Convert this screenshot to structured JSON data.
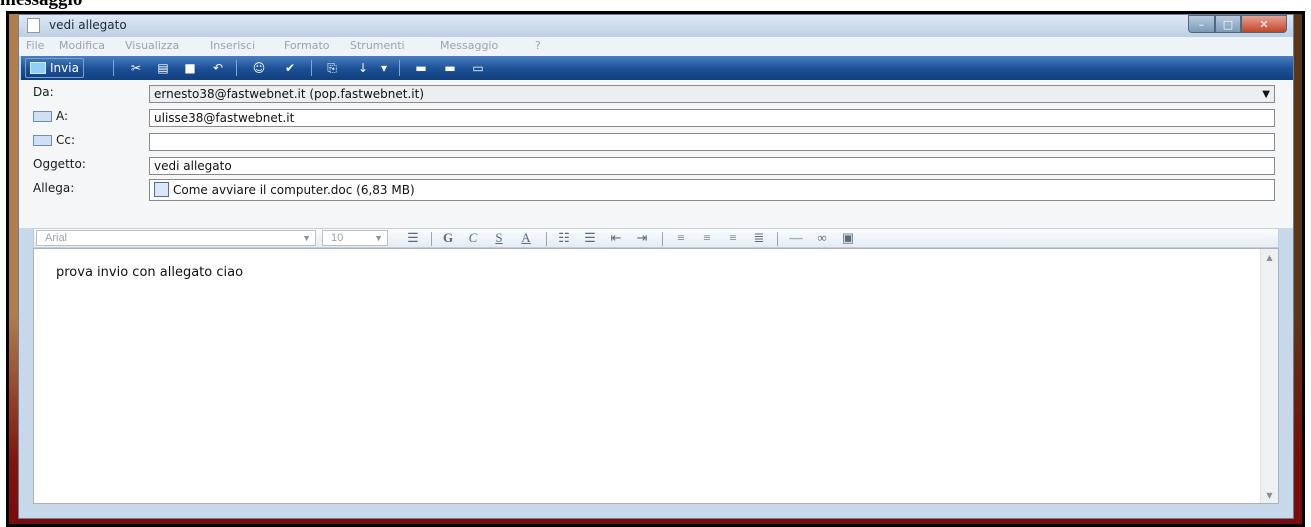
{
  "caption": "messaggio",
  "window": {
    "title": "vedi allegato"
  },
  "window_buttons": {
    "minimize": "–",
    "maximize": "□",
    "close": "✕"
  },
  "menu": [
    "File",
    "Modifica",
    "Visualizza",
    "Inserisci",
    "Formato",
    "Strumenti",
    "Messaggio",
    "?"
  ],
  "toolbar": {
    "send_label": "Invia"
  },
  "form": {
    "from": {
      "label": "Da:",
      "value": "ernesto38@fastwebnet.it   (pop.fastwebnet.it)"
    },
    "to": {
      "label": "A:",
      "value": "ulisse38@fastwebnet.it"
    },
    "cc": {
      "label": "Cc:",
      "value": ""
    },
    "subject": {
      "label": "Oggetto:",
      "value": "vedi allegato"
    },
    "attach": {
      "label": "Allega:",
      "value": "Come avviare il computer.doc (6,83 MB)"
    }
  },
  "format": {
    "font": "Arial",
    "size": "10",
    "icons": [
      "paragraph-style-icon",
      "bold-icon",
      "italic-icon",
      "underline-icon",
      "font-color-icon",
      "numbered-list-icon",
      "bullet-list-icon",
      "decrease-indent-icon",
      "increase-indent-icon",
      "align-left-icon",
      "align-center-icon",
      "align-right-icon",
      "justify-icon",
      "horizontal-line-icon",
      "hyperlink-icon",
      "insert-image-icon"
    ],
    "glyphs": {
      "bold": "G",
      "italic": "C",
      "underline": "S",
      "color": "A"
    }
  },
  "message": {
    "body": "prova invio con allegato ciao"
  },
  "colors": {
    "toolbar": "#1b4f95",
    "window": "#c7d8ea",
    "close": "#c0452c"
  }
}
